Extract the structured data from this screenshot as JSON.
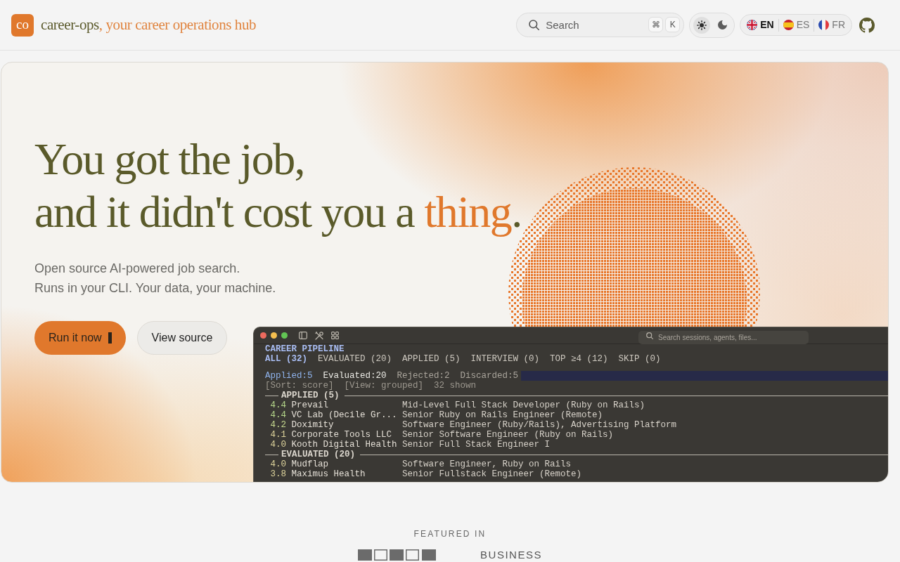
{
  "header": {
    "logo": "co",
    "brand": "career-ops",
    "tagline": ", your career operations hub",
    "search": {
      "placeholder": "Search",
      "keys": [
        "⌘",
        "K"
      ]
    },
    "theme": [
      {
        "kind": "light",
        "selected": true
      },
      {
        "kind": "dark",
        "selected": false
      }
    ],
    "languages": [
      {
        "kind": "gb",
        "label": "EN",
        "selected": true
      },
      {
        "kind": "es",
        "label": "ES",
        "selected": false
      },
      {
        "kind": "fr",
        "label": "FR",
        "selected": false
      }
    ]
  },
  "hero": {
    "headline": [
      [
        {
          "text": "You got the job,",
          "accent": false
        }
      ],
      [
        {
          "text": "and it didn't cost you a ",
          "accent": false
        },
        {
          "text": "thing",
          "accent": true
        },
        {
          "text": ".",
          "accent": false
        }
      ]
    ],
    "subtitle": [
      "Open source AI-powered job search.",
      "Runs in your CLI. Your data, your machine."
    ],
    "buttons": [
      {
        "label": "Run it now",
        "kind": "primary",
        "cursor": true
      },
      {
        "label": "View source",
        "kind": "secondary"
      }
    ]
  },
  "terminal": {
    "search": {
      "placeholder": "Search sessions, agents, files..."
    },
    "title": "CAREER PIPELINE",
    "tabs": [
      {
        "label": "ALL (32)",
        "selected": true
      },
      {
        "label": "EVALUATED (20)",
        "selected": false
      },
      {
        "label": "APPLIED (5)",
        "selected": false
      },
      {
        "label": "INTERVIEW (0)",
        "selected": false
      },
      {
        "label": "TOP ≥4 (12)",
        "selected": false
      },
      {
        "label": "SKIP (0)",
        "selected": false
      }
    ],
    "summary": {
      "highlighted": true,
      "items": [
        {
          "text": "Applied:5",
          "color": "#8fb3ec"
        },
        {
          "text": "Evaluated:20",
          "color": "#ecebe6"
        },
        {
          "text": "Rejected:2",
          "color": "#aaa59c"
        },
        {
          "text": "Discarded:5",
          "color": "#aaa59c"
        }
      ]
    },
    "view_info": "[Sort: score]  [View: grouped]  32 shown",
    "groups": [
      {
        "title": "APPLIED (5)",
        "rows": [
          {
            "score": "4.4",
            "color": "#b7d98b",
            "company": "Prevail",
            "role": "Mid-Level Full Stack Developer (Ruby on Rails)"
          },
          {
            "score": "4.4",
            "color": "#b7d98b",
            "company": "VC Lab (Decile Gr...",
            "role": "Senior Ruby on Rails Engineer (Remote)"
          },
          {
            "score": "4.2",
            "color": "#c6d98f",
            "company": "Doximity",
            "role": "Software Engineer (Ruby/Rails), Advertising Platform"
          },
          {
            "score": "4.1",
            "color": "#ddd39b",
            "company": "Corporate Tools LLC",
            "role": "Senior Software Engineer (Ruby on Rails)"
          },
          {
            "score": "4.0",
            "color": "#ddd39b",
            "company": "Kooth Digital Health",
            "role": "Senior Full Stack Engineer I"
          }
        ]
      },
      {
        "title": "EVALUATED (20)",
        "rows": [
          {
            "score": "4.0",
            "color": "#ddd39b",
            "company": "Mudflap",
            "role": "Software Engineer, Ruby on Rails"
          },
          {
            "score": "3.8",
            "color": "#ddd39b",
            "company": "Maximus Health",
            "role": "Senior Fullstack Engineer (Remote)"
          }
        ]
      }
    ]
  },
  "featured": {
    "label": "FEATURED IN",
    "logos": [
      {
        "kind": "boxes"
      },
      {
        "kind": "text",
        "text": "BUSINESS"
      }
    ]
  }
}
